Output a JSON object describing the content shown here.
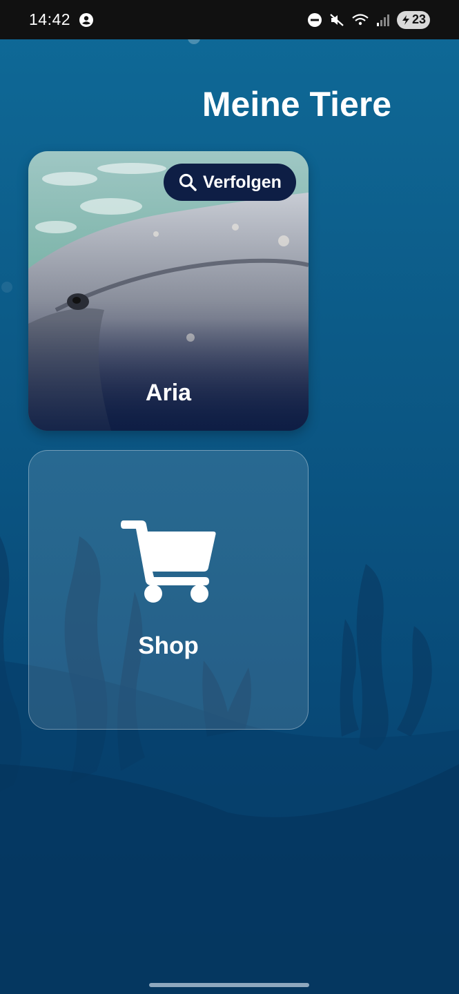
{
  "status_bar": {
    "time": "14:42",
    "battery": "23",
    "icons": [
      "account-circle-icon",
      "do-not-disturb-icon",
      "mute-icon",
      "wifi-icon",
      "signal-icon",
      "battery-icon"
    ]
  },
  "header": {
    "title": "Meine Tiere"
  },
  "animals": [
    {
      "name": "Aria",
      "track_label": "Verfolgen",
      "track_icon": "search-icon"
    }
  ],
  "shop": {
    "label": "Shop",
    "icon": "cart-icon"
  },
  "colors": {
    "background_top": "#0f6a98",
    "background_bottom": "#063c66",
    "track_button": "#0e1e45",
    "text": "#ffffff"
  }
}
